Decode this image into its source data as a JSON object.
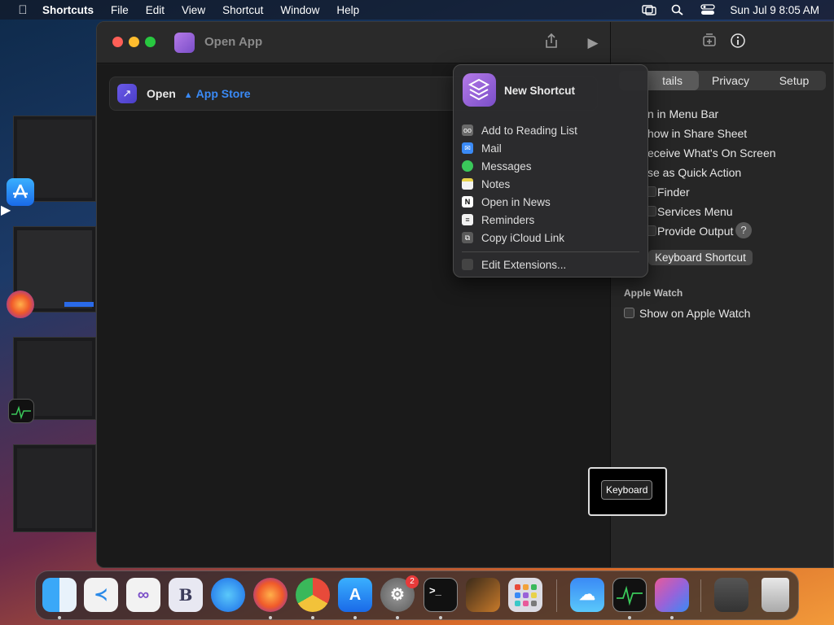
{
  "menubar": {
    "app_name": "Shortcuts",
    "items": [
      "File",
      "Edit",
      "View",
      "Shortcut",
      "Window",
      "Help"
    ],
    "clock": "Sun Jul 9  8:05 AM"
  },
  "window": {
    "title": "Open App",
    "action": {
      "verb": "Open",
      "app": "App Store"
    }
  },
  "panel": {
    "tabs": [
      "Details",
      "Privacy",
      "Setup"
    ],
    "tab_visible_text": "tails",
    "selected_tab": "Details",
    "rows": [
      "n in Menu Bar",
      "how in Share Sheet",
      "eceive What's On Screen",
      "se as Quick Action",
      "Finder",
      "Services Menu",
      "Provide Output"
    ],
    "keyboard_shortcut_label": "Keyboard Shortcut",
    "apple_watch_heading": "Apple Watch",
    "show_on_apple_watch": "Show on Apple Watch",
    "help_label": "?"
  },
  "popup": {
    "header": "New Shortcut",
    "items": [
      {
        "label": "Add to Reading List",
        "icon": "glasses-icon",
        "color": "#6a6a6a"
      },
      {
        "label": "Mail",
        "icon": "mail-icon",
        "color": "#3a8af6"
      },
      {
        "label": "Messages",
        "icon": "messages-icon",
        "color": "#3ac85a"
      },
      {
        "label": "Notes",
        "icon": "notes-icon",
        "color": "#e8d24a"
      },
      {
        "label": "Open in News",
        "icon": "news-icon",
        "color": "#ffffff"
      },
      {
        "label": "Reminders",
        "icon": "reminders-icon",
        "color": "#ffffff"
      },
      {
        "label": "Copy iCloud Link",
        "icon": "copy-icon",
        "color": "#6a6a6a"
      }
    ],
    "edit_extensions": "Edit Extensions..."
  },
  "hud": {
    "label": "Keyboard"
  },
  "dock": {
    "apps": [
      "Finder",
      "Visual Studio Code",
      "Visual Studio",
      "BBEdit",
      "Safari",
      "Firefox",
      "Chrome",
      "App Store",
      "System Settings",
      "Terminal",
      "GarageBand",
      "Launchpad",
      "Weather",
      "Activity Monitor",
      "Shortcuts",
      "Downloads",
      "Trash"
    ],
    "settings_badge": "2"
  },
  "colors": {
    "accent": "#3a8af6",
    "shortcut_purple": "#9a62d8"
  }
}
